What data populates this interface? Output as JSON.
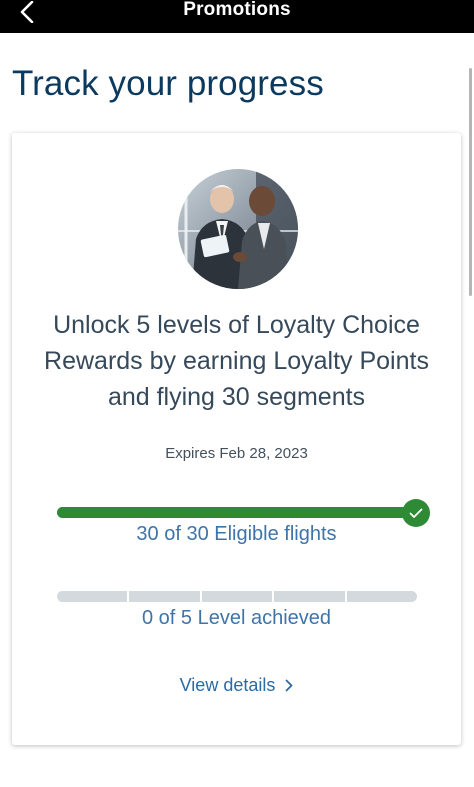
{
  "header": {
    "title": "Promotions",
    "back_icon": "chevron-left-icon"
  },
  "page": {
    "title": "Track your progress"
  },
  "promo_card": {
    "image_alt": "two businessmen looking at tablet",
    "headline": "Unlock 5 levels of Loyalty Choice Rewards by earning Loyalty Points and flying 30 segments",
    "expires": "Expires Feb 28, 2023",
    "flights": {
      "label": "30 of 30 Eligible flights",
      "current": 30,
      "total": 30,
      "progress_fraction": 1.0,
      "complete_icon": "check-icon"
    },
    "levels": {
      "label": "0 of 5 Level achieved",
      "current": 0,
      "total": 5,
      "progress_fraction": 0.0
    },
    "view_details_label": "View details",
    "view_details_icon": "chevron-right-icon"
  },
  "colors": {
    "header_bg": "#000000",
    "title_navy": "#0b3a5e",
    "progress_green": "#2e8a35",
    "track_gray": "#d4d9de",
    "link_blue": "#3f74a8"
  }
}
